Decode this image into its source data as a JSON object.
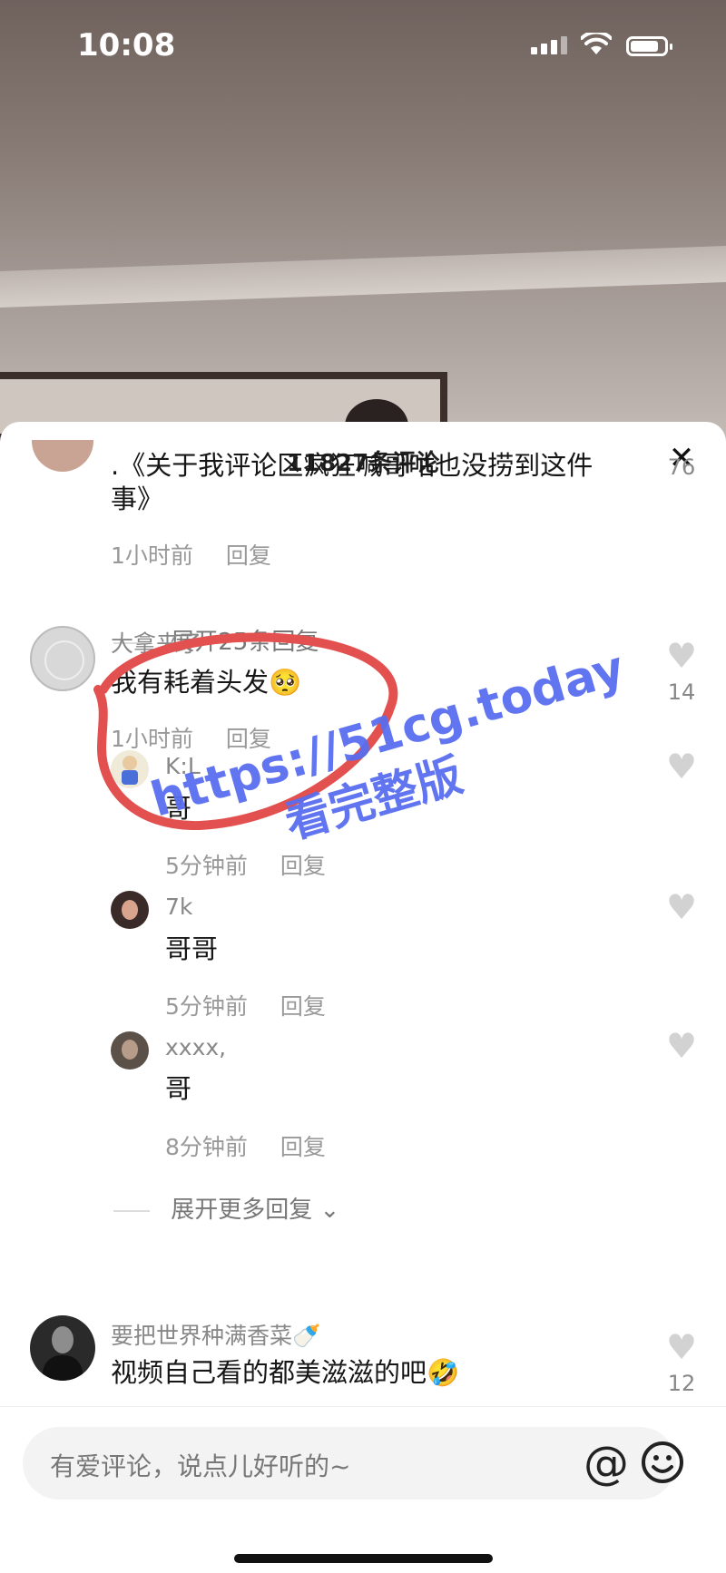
{
  "status_bar": {
    "time": "10:08"
  },
  "comments_sheet": {
    "title": "11827条评论",
    "top_comment_partial": {
      "text_line1": ".《关于我评论区疯狂喊哥咕也没捞到这件",
      "text_line2": "事》",
      "time": "1小时前",
      "reply_label": "回复",
      "likes": "76",
      "expand": "展开25条回复"
    },
    "main_comment": {
      "username": "大拿来了",
      "text": "我有耗着头发",
      "emoji": "🥺",
      "time": "1小时前",
      "reply_label": "回复",
      "likes": "14"
    },
    "replies": [
      {
        "username": "K:L",
        "text": "哥",
        "time": "5分钟前",
        "reply_label": "回复"
      },
      {
        "username": "7k",
        "text": "哥哥",
        "time": "5分钟前",
        "reply_label": "回复"
      },
      {
        "username": "xxxx,",
        "text": "哥",
        "time": "8分钟前",
        "reply_label": "回复"
      }
    ],
    "expand_more": "展开更多回复",
    "next_comment": {
      "username": "要把世界种满香菜",
      "username_emoji": "🍼",
      "text": "视频自己看的都美滋滋的吧",
      "emoji": "🤣",
      "likes": "12"
    }
  },
  "watermark": {
    "line1": "https://51cg.today",
    "line2": "看完整版"
  },
  "input_bar": {
    "placeholder": "有爱评论，说点儿好听的~"
  },
  "icons": [
    "signal-icon",
    "wifi-icon",
    "battery-icon",
    "close-icon",
    "heart-icon",
    "chevron-down-icon",
    "at-icon",
    "emoji-icon"
  ]
}
